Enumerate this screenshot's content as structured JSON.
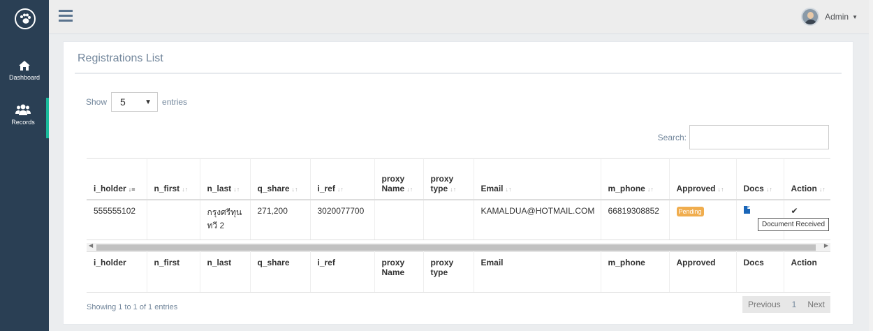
{
  "sidebar": {
    "items": [
      {
        "label": "Dashboard",
        "icon": "home-icon"
      },
      {
        "label": "Records",
        "icon": "users-icon"
      }
    ]
  },
  "topbar": {
    "user_name": "Admin"
  },
  "panel": {
    "title": "Registrations List",
    "show_label": "Show",
    "entries_value": "5",
    "entries_label": "entries",
    "search_label": "Search:",
    "search_value": ""
  },
  "table": {
    "headers": [
      "i_holder",
      "n_first",
      "n_last",
      "q_share",
      "i_ref",
      "proxy Name",
      "proxy type",
      "Email",
      "m_phone",
      "Approved",
      "Docs",
      "Action"
    ],
    "rows": [
      {
        "i_holder": "555555102",
        "n_first": "",
        "n_last": "กรุงศรีทุนทวี 2",
        "q_share": "271,200",
        "i_ref": "3020077700",
        "proxy_name": "",
        "proxy_type": "",
        "email": "KAMALDUA@HOTMAIL.COM",
        "m_phone": "66819308852",
        "approved": "Pending",
        "action": "✔"
      }
    ]
  },
  "tooltip": "Document Received",
  "footer": {
    "info": "Showing 1 to 1 of 1 entries",
    "prev": "Previous",
    "page": "1",
    "next": "Next"
  },
  "colors": {
    "sidebar": "#2a3f54",
    "accent": "#1abb9c",
    "badge": "#f0ad4e"
  }
}
